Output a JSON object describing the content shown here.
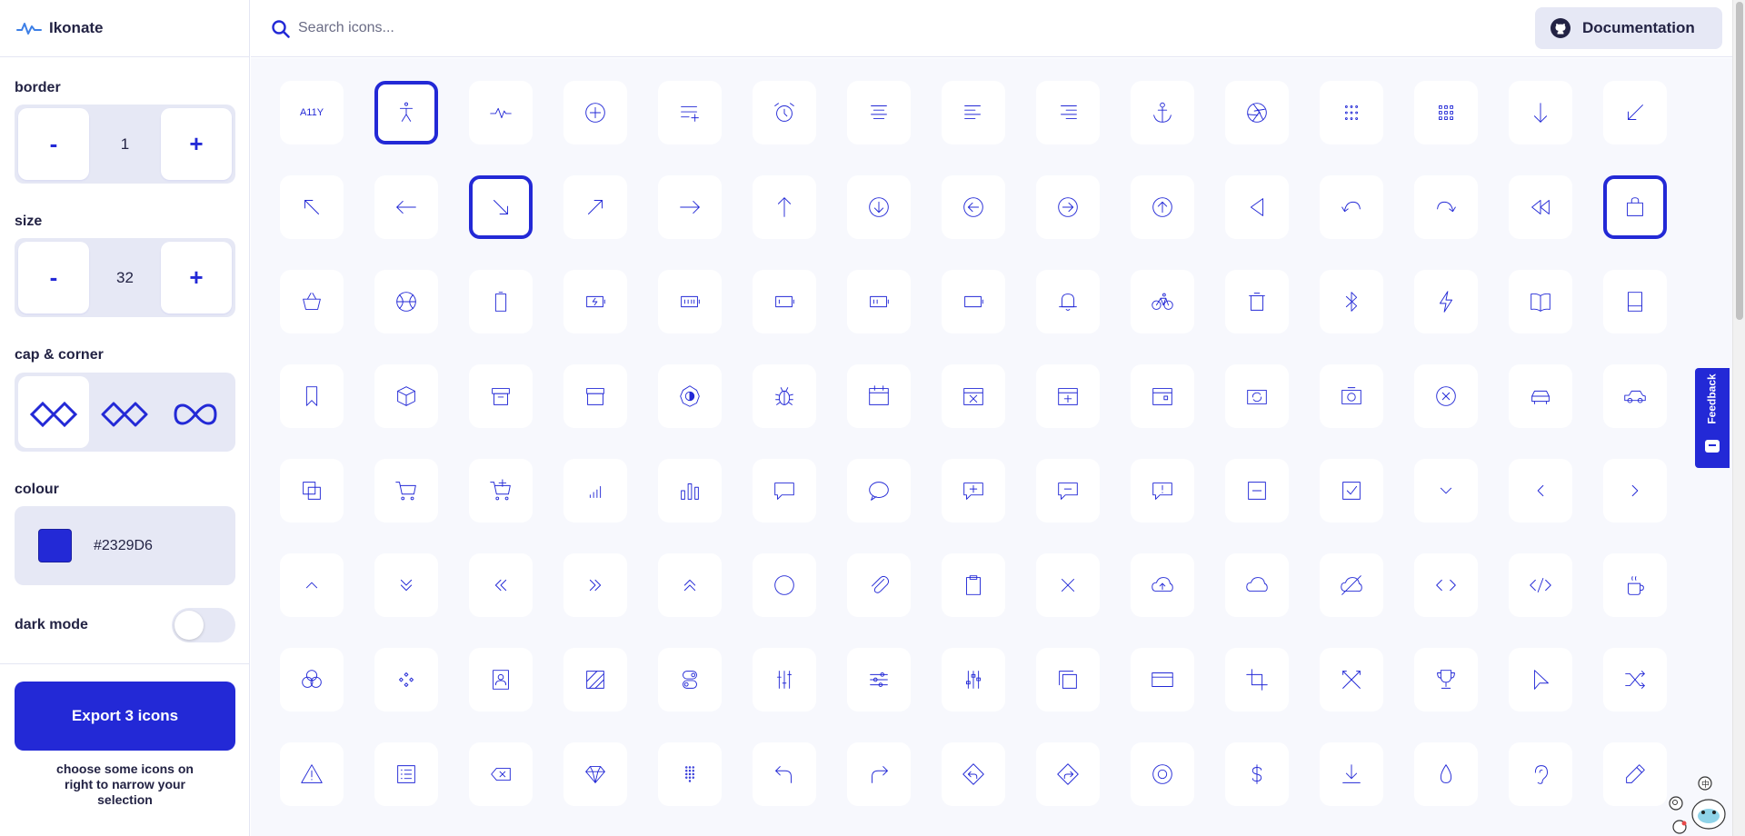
{
  "app": {
    "title": "Ikonate"
  },
  "header": {
    "search_placeholder": "Search icons...",
    "search_value": "",
    "doc_label": "Documentation"
  },
  "sidebar": {
    "border": {
      "label": "border",
      "value": "1",
      "minus": "-",
      "plus": "+"
    },
    "size": {
      "label": "size",
      "value": "32",
      "minus": "-",
      "plus": "+"
    },
    "cap": {
      "label": "cap & corner",
      "options": [
        "square",
        "round-miter",
        "round"
      ],
      "selected": "square"
    },
    "colour": {
      "label": "colour",
      "value": "#2329D6"
    },
    "dark_mode": {
      "label": "dark mode",
      "on": false
    },
    "export_label": "Export 3 icons",
    "export_hint": "choose some icons on right to narrow your selection"
  },
  "feedback": {
    "label": "Feedback"
  },
  "colors": {
    "accent": "#2329D6",
    "tile_bg": "#ffffff",
    "page_bg": "#f7f8fd",
    "panel_bg": "#e6e8f5"
  },
  "icons": [
    [
      "a11y",
      "accessibility",
      "activity",
      "add",
      "add-to-list",
      "alarm",
      "align-center",
      "align-left",
      "align-right",
      "anchor",
      "aperture",
      "apps",
      "apps-alt",
      "arrow-down",
      "arrow-down-left"
    ],
    [
      "arrow-up-left",
      "arrow-left",
      "arrow-down-right",
      "arrow-up-right",
      "arrow-right",
      "arrow-up",
      "arrow-down-circle",
      "arrow-left-circle",
      "arrow-right-circle",
      "arrow-up-circle",
      "back",
      "back-alt",
      "forward",
      "rewind",
      "bag"
    ],
    [
      "basket",
      "basketball",
      "battery-empty",
      "battery-charging",
      "battery-full",
      "battery-low",
      "battery-medium",
      "battery",
      "bell",
      "bicycle",
      "bin",
      "bluetooth",
      "bolt",
      "book-opened",
      "book"
    ],
    [
      "bookmark",
      "box",
      "box-alt",
      "archive",
      "brightness",
      "bug",
      "calendar",
      "calendar-remove",
      "calendar-add",
      "calendar-event",
      "camera-rotate",
      "camera",
      "cancel",
      "car",
      "car-alt"
    ],
    [
      "layers",
      "cart",
      "cart-add",
      "chart-bars-low",
      "chart",
      "chat",
      "chat-bubble",
      "chat-add",
      "chat-remove",
      "chat-error",
      "minus-square",
      "checkbox",
      "chevron-down",
      "chevron-left",
      "chevron-right"
    ],
    [
      "chevron-up",
      "chevrons-down",
      "chevrons-left",
      "chevrons-right",
      "chevrons-up",
      "circle",
      "clip",
      "clipboard",
      "close",
      "cloud-upload",
      "cloud",
      "cloud-off",
      "code",
      "code-alt",
      "coffee"
    ],
    [
      "colour-circles",
      "component",
      "contact",
      "crop-pattern",
      "toggle",
      "sliders-vertical",
      "sliders-horizontal",
      "equalizer",
      "copy",
      "credit-card",
      "crop",
      "crossed-tools",
      "trophy",
      "cursor",
      "shuffle"
    ],
    [
      "danger",
      "list-box",
      "backspace",
      "diamond",
      "dots-grid",
      "undo",
      "redo",
      "directions-left",
      "directions-right",
      "disc",
      "dollar",
      "download",
      "drop",
      "ear",
      "edit"
    ]
  ],
  "selected_icons": [
    "accessibility",
    "arrow-down-right",
    "bag"
  ]
}
